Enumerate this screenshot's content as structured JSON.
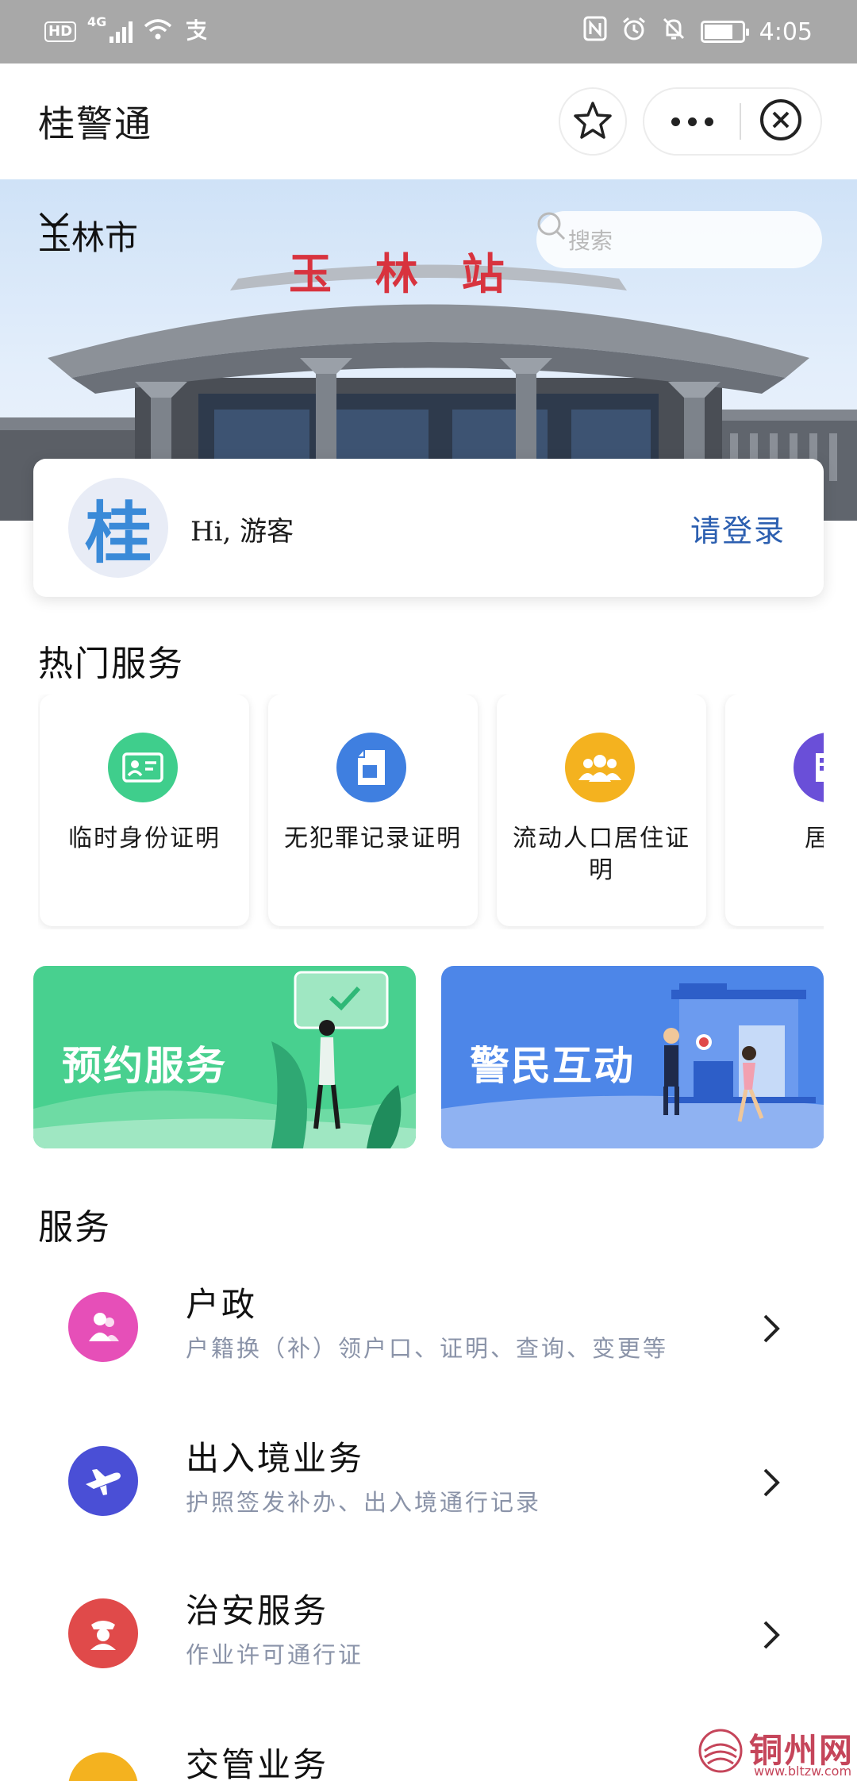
{
  "status_bar": {
    "left_badges": [
      "HD",
      "4G"
    ],
    "time": "4:05",
    "icons": [
      "signal-icon",
      "wifi-icon",
      "alipay-icon",
      "nfc-icon",
      "alarm-icon",
      "mute-icon",
      "battery-icon"
    ]
  },
  "nav": {
    "title": "桂警通",
    "icons": [
      "star-icon",
      "more-icon",
      "close-icon"
    ]
  },
  "banner": {
    "city": "玉林市",
    "station_sign": "玉 林 站",
    "search_placeholder": "搜索"
  },
  "user": {
    "avatar_text": "桂",
    "greeting": "Hi, 游客",
    "login_label": "请登录"
  },
  "hot": {
    "title": "热门服务",
    "items": [
      {
        "label": "临时身份证明",
        "icon": "id-card-icon",
        "color": "#3fce8c"
      },
      {
        "label": "无犯罪记录证明",
        "icon": "document-icon",
        "color": "#3f7fe0"
      },
      {
        "label": "流动人口居住证明",
        "icon": "people-icon",
        "color": "#f4b21f"
      },
      {
        "label": "居住",
        "icon": "building-icon",
        "color": "#6a4fd8"
      }
    ]
  },
  "promos": [
    {
      "label": "预约服务",
      "color": "#48d08f"
    },
    {
      "label": "警民互动",
      "color": "#4d86e8"
    }
  ],
  "services": {
    "title": "服务",
    "items": [
      {
        "title": "户政",
        "subtitle": "户籍换（补）领户口、证明、查询、变更等",
        "icon": "household-icon",
        "color": "#e64fb8"
      },
      {
        "title": "出入境业务",
        "subtitle": "护照签发补办、出入境通行记录",
        "icon": "airplane-icon",
        "color": "#4a4fd6"
      },
      {
        "title": "治安服务",
        "subtitle": "作业许可通行证",
        "icon": "police-icon",
        "color": "#e04a4a"
      },
      {
        "title": "交管业务",
        "subtitle": "",
        "icon": "traffic-icon",
        "color": "#f4b21f"
      }
    ]
  },
  "watermark": {
    "text": "铜州网",
    "url": "www.bltzw.com"
  }
}
